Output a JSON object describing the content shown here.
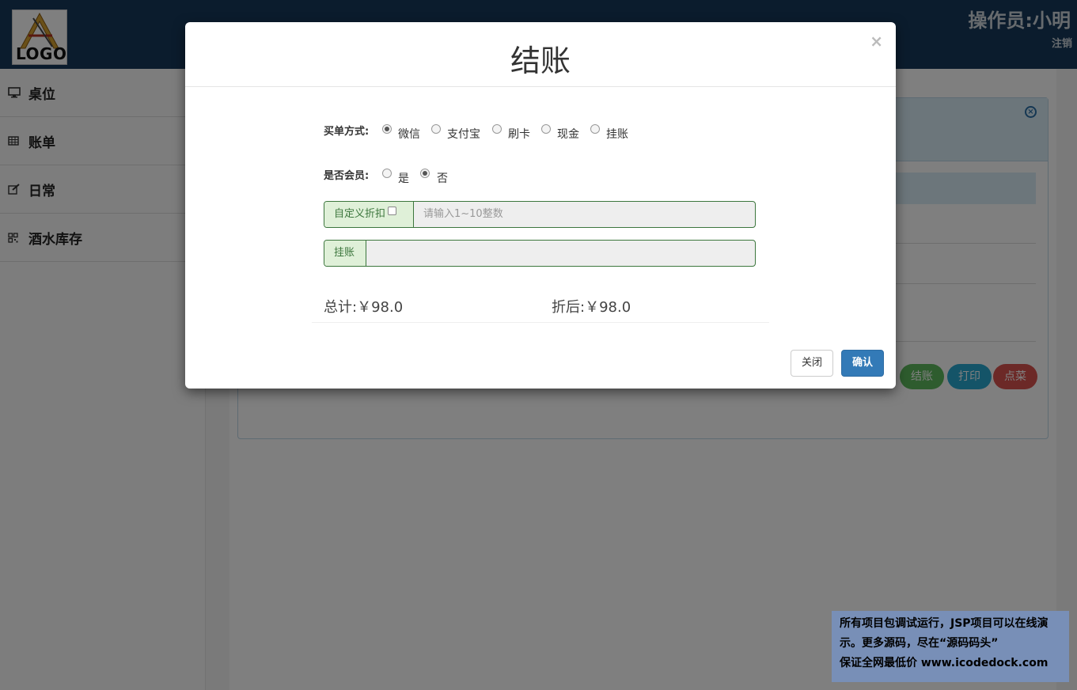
{
  "header": {
    "logo_text": "LOGO",
    "operator": "操作员:小明",
    "logout": "注销"
  },
  "sidebar": {
    "items": [
      {
        "label": "桌位",
        "icon": "monitor-icon"
      },
      {
        "label": "账单",
        "icon": "table-icon"
      },
      {
        "label": "日常",
        "icon": "edit-icon"
      },
      {
        "label": "酒水库存",
        "icon": "qrcode-icon"
      }
    ]
  },
  "background_actions": {
    "checkout": "结账",
    "print": "打印",
    "order": "点菜"
  },
  "modal": {
    "title": "结账",
    "close_glyph": "×",
    "payment_label": "买单方式:",
    "payment_options": [
      {
        "label": "微信",
        "checked": true
      },
      {
        "label": "支付宝",
        "checked": false
      },
      {
        "label": "刷卡",
        "checked": false
      },
      {
        "label": "现金",
        "checked": false
      },
      {
        "label": "挂账",
        "checked": false
      }
    ],
    "member_label": "是否会员:",
    "member_options": [
      {
        "label": "是",
        "checked": false
      },
      {
        "label": "否",
        "checked": true
      }
    ],
    "discount_addon": "自定义折扣",
    "discount_checked": false,
    "discount_placeholder": "请输入1~10整数",
    "credit_addon": "挂账",
    "credit_value": "",
    "total_label": "总计:￥98.0",
    "discounted_label": "折后:￥98.0",
    "close_button": "关闭",
    "confirm_button": "确认"
  },
  "watermark": {
    "line1": "所有项目包调试运行，JSP项目可以在线演",
    "line2": "示。更多源码，尽在“源码码头”",
    "line3": "保证全网最低价 www.icodedock.com"
  },
  "colors": {
    "header_bg": "#17385a",
    "primary": "#337ab7",
    "success_border": "#3c763d",
    "success_bg": "#dff0d8"
  }
}
